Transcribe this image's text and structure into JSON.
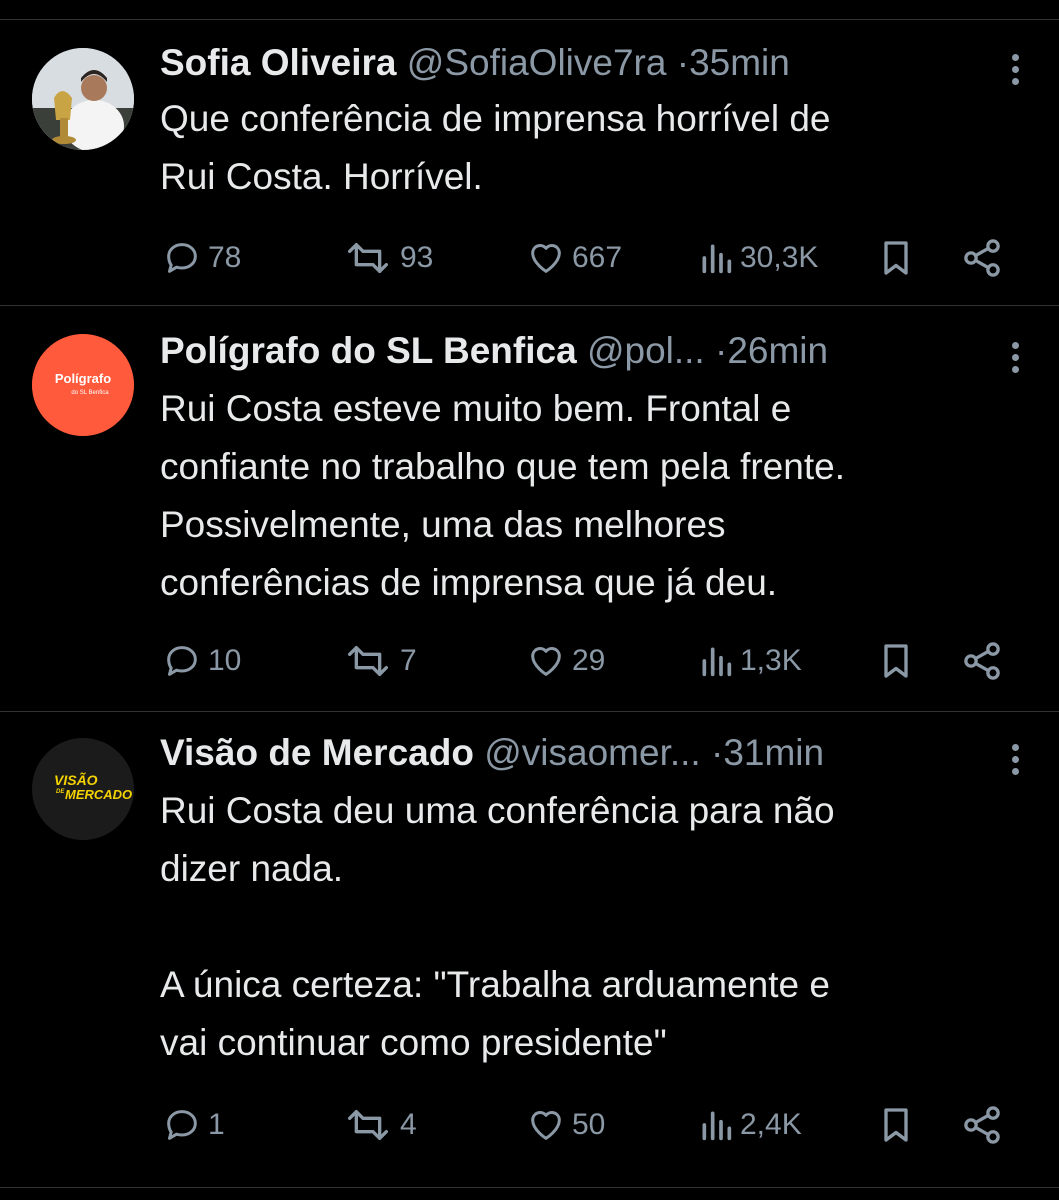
{
  "tweets": [
    {
      "name": "Sofia Oliveira",
      "handle": "@SofiaOlive7ra",
      "time": "35min",
      "text": "Que conferência de imprensa horrível de\nRui Costa. Horrível.",
      "replies": "78",
      "retweets": "93",
      "likes": "667",
      "views": "30,3K",
      "avatar": "photo-avatar"
    },
    {
      "name": "Polígrafo do SL Benfica",
      "handle": "@pol...",
      "time": "26min",
      "text": "Rui Costa esteve muito bem. Frontal e\nconfiante no trabalho que tem pela frente.\nPossivelmente, uma das melhores\nconferências de imprensa que já deu.",
      "replies": "10",
      "retweets": "7",
      "likes": "29",
      "views": "1,3K",
      "avatar_line1": "Polígrafo",
      "avatar_line2": "do SL Benfica",
      "avatar_color": "#ff5a3c"
    },
    {
      "name": "Visão de Mercado",
      "handle": "@visaomer...",
      "time": "31min",
      "text": "Rui Costa deu uma conferência para não\ndizer nada.\n\nA única certeza: \"Trabalha arduamente e\nvai continuar como presidente\"",
      "replies": "1",
      "retweets": "4",
      "likes": "50",
      "views": "2,4K",
      "avatar_line1": "VISÃO",
      "avatar_line2": "DE",
      "avatar_line3": "MERCADO",
      "avatar_color": "#f5d300"
    }
  ],
  "separator": "·",
  "colors": {
    "background": "#000000",
    "text": "#e7e9ea",
    "muted": "#8b98a5",
    "border": "#2f3336"
  },
  "icons": [
    "reply-icon",
    "retweet-icon",
    "like-icon",
    "views-icon",
    "bookmark-icon",
    "share-icon",
    "more-icon"
  ]
}
